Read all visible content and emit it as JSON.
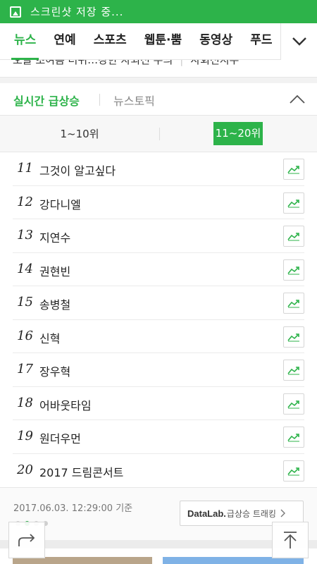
{
  "status_bar": {
    "icon": "gallery-icon",
    "text": "스크린샷 저장 중..."
  },
  "nav": {
    "tabs": [
      "뉴스",
      "연예",
      "스포츠",
      "웹툰·뿜",
      "동영상",
      "푸드"
    ],
    "active_tab": "뉴스",
    "more_icon": "chevron-down-icon"
  },
  "ticker": {
    "headline": "오늘 초여름 더위…강한 자외선 주의",
    "category": "사회전지두"
  },
  "section": {
    "title_active": "실시간 급상승",
    "title_other": "뉴스토픽",
    "collapse_icon": "chevron-up-icon"
  },
  "range_tabs": {
    "first": "1~10위",
    "second": "11~20위",
    "active": "11~20위"
  },
  "items": [
    {
      "rank": "11",
      "name": "그것이 알고싶다"
    },
    {
      "rank": "12",
      "name": "강다니엘"
    },
    {
      "rank": "13",
      "name": "지연수"
    },
    {
      "rank": "14",
      "name": "권현빈"
    },
    {
      "rank": "15",
      "name": "송병철"
    },
    {
      "rank": "16",
      "name": "신혁"
    },
    {
      "rank": "17",
      "name": "장우혁"
    },
    {
      "rank": "18",
      "name": "어바웃타임"
    },
    {
      "rank": "19",
      "name": "원더우먼"
    },
    {
      "rank": "20",
      "name": "2017 드림콘서트"
    }
  ],
  "footer": {
    "timestamp": "2017.06.03. 12:29:00 기준",
    "datalab_brand": "DataLab.",
    "datalab_text": "급상승 트래킹"
  },
  "colors": {
    "accent": "#2db34a",
    "divider": "#e6e6e6"
  }
}
